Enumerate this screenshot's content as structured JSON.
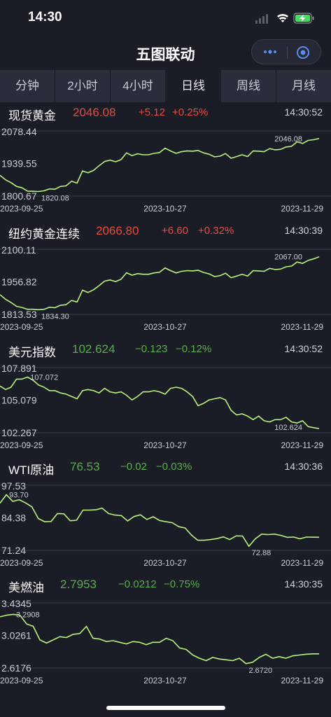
{
  "status_bar": {
    "time": "14:30",
    "battery_color": "#4cd964"
  },
  "navbar": {
    "title": "五图联动"
  },
  "tabs": [
    {
      "label": "分钟",
      "active": false
    },
    {
      "label": "2小时",
      "active": false
    },
    {
      "label": "4小时",
      "active": false
    },
    {
      "label": "日线",
      "active": true
    },
    {
      "label": "周线",
      "active": false
    },
    {
      "label": "月线",
      "active": false
    }
  ],
  "colors": {
    "up": "#e8493d",
    "down": "#52b044",
    "line": "#b8f27a",
    "background": "#1b1d26"
  },
  "panels": [
    {
      "name": "现货黄金",
      "price": "2046.08",
      "change": "+5.12",
      "pct": "+0.25%",
      "time": "14:30:52",
      "direction": "up"
    },
    {
      "name": "纽约黄金连续",
      "price": "2066.80",
      "change": "+6.60",
      "pct": "+0.32%",
      "time": "14:30:39",
      "direction": "up"
    },
    {
      "name": "美元指数",
      "price": "102.624",
      "change": "−0.123",
      "pct": "−0.12%",
      "time": "14:30:52",
      "direction": "down"
    },
    {
      "name": "WTI原油",
      "price": "76.53",
      "change": "−0.02",
      "pct": "−0.03%",
      "time": "14:30:36",
      "direction": "down"
    },
    {
      "name": "美燃油",
      "price": "2.7953",
      "change": "−0.0212",
      "pct": "−0.75%",
      "time": "14:30:35",
      "direction": "down"
    }
  ],
  "chart_data": [
    {
      "type": "line",
      "title": "现货黄金",
      "y_ticks": [
        "2078.44",
        "1939.55",
        "1800.67"
      ],
      "ylim": [
        1800.67,
        2078.44
      ],
      "x_ticks": [
        "2023-09-25",
        "2023-10-27",
        "2023-11-29"
      ],
      "low_label": "1820.08",
      "last_label": "2046.08",
      "values": [
        1889,
        1870,
        1858,
        1842,
        1836,
        1822,
        1821,
        1820.08,
        1823,
        1831,
        1830,
        1842,
        1844,
        1864,
        1856,
        1908,
        1900,
        1910,
        1930,
        1948,
        1954,
        1947,
        1956,
        1985,
        1973,
        1981,
        1977,
        1977,
        1983,
        1986,
        2005,
        1993,
        1983,
        1990,
        1993,
        1992,
        1995,
        1985,
        1979,
        1968,
        1971,
        1982,
        1962,
        1969,
        1977,
        1969,
        1993,
        1992,
        1990,
        2003,
        1998,
        2000,
        2010,
        2013,
        2032,
        2025,
        2038,
        2041,
        2046.08
      ]
    },
    {
      "type": "line",
      "title": "纽约黄金连续",
      "y_ticks": [
        "2100.11",
        "1956.82",
        "1813.53"
      ],
      "ylim": [
        1813.53,
        2100.11
      ],
      "x_ticks": [
        "2023-09-25",
        "2023-10-27",
        "2023-11-29"
      ],
      "low_label": "1834.30",
      "last_label": "2067.00",
      "values": [
        1900,
        1880,
        1866,
        1849,
        1844,
        1836,
        1836,
        1834.3,
        1836,
        1845,
        1843,
        1854,
        1856,
        1875,
        1868,
        1920,
        1910,
        1922,
        1940,
        1960,
        1965,
        1958,
        1968,
        1997,
        1986,
        1993,
        1990,
        1990,
        1996,
        1999,
        2018,
        2006,
        1996,
        2003,
        2006,
        2005,
        2008,
        1998,
        1992,
        1980,
        1984,
        1995,
        1975,
        1982,
        1990,
        1982,
        2006,
        2005,
        2003,
        2016,
        2011,
        2013,
        2023,
        2026,
        2044,
        2038,
        2051,
        2058,
        2067.0
      ]
    },
    {
      "type": "line",
      "title": "美元指数",
      "y_ticks": [
        "107.891",
        "105.079",
        "102.267"
      ],
      "ylim": [
        102.267,
        107.891
      ],
      "x_ticks": [
        "2023-09-25",
        "2023-10-27",
        "2023-11-29"
      ],
      "high_label": "107.072",
      "last_label": "102.624",
      "values": [
        106.3,
        106.0,
        106.2,
        106.9,
        106.9,
        107.072,
        106.8,
        106.4,
        106.2,
        105.9,
        105.9,
        105.7,
        105.6,
        105.4,
        105.2,
        105.9,
        106.0,
        105.9,
        105.7,
        106.1,
        105.8,
        105.7,
        105.8,
        105.5,
        105.1,
        105.4,
        105.8,
        105.8,
        105.9,
        105.8,
        105.6,
        106.1,
        106.2,
        106.1,
        105.8,
        105.4,
        104.6,
        104.8,
        105.1,
        105.2,
        105.3,
        105.1,
        104.2,
        103.8,
        103.9,
        103.7,
        103.4,
        103.7,
        103.3,
        103.2,
        103.4,
        103.4,
        103.6,
        103.2,
        103.1,
        103.3,
        102.8,
        102.7,
        102.624
      ]
    },
    {
      "type": "line",
      "title": "WTI原油",
      "y_ticks": [
        "97.53",
        "84.38",
        "71.24"
      ],
      "ylim": [
        71.24,
        97.53
      ],
      "x_ticks": [
        "2023-09-25",
        "2023-10-27",
        "2023-11-29"
      ],
      "high_label": "93.70",
      "low_label": "72.88",
      "values": [
        90.3,
        93.7,
        91.0,
        91.7,
        90.4,
        88.8,
        84.1,
        82.8,
        82.9,
        86.1,
        86.0,
        83.2,
        83.4,
        87.5,
        87.5,
        87.6,
        88.3,
        86.1,
        85.5,
        85.3,
        83.1,
        84.9,
        85.6,
        83.7,
        84.8,
        83.3,
        82.8,
        82.4,
        80.8,
        80.3,
        77.4,
        75.3,
        75.3,
        75.6,
        76.0,
        76.7,
        75.6,
        77.1,
        77.0,
        72.88,
        75.9,
        77.8,
        77.6,
        77.8,
        77.3,
        76.5,
        76.6,
        75.9,
        76.6,
        76.55,
        76.53
      ]
    },
    {
      "type": "line",
      "title": "美燃油",
      "y_ticks": [
        "3.4345",
        "3.0261",
        "2.6176"
      ],
      "ylim": [
        2.6176,
        3.4345
      ],
      "x_ticks": [
        "2023-09-25",
        "2023-10-27",
        "2023-11-29"
      ],
      "high_label": "3.2908",
      "low_label": "2.6720",
      "last_label": "",
      "values": [
        3.26,
        3.28,
        3.2908,
        3.28,
        3.17,
        3.14,
        2.97,
        2.93,
        2.97,
        3.01,
        3.0,
        3.04,
        3.05,
        3.14,
        2.99,
        2.98,
        2.95,
        2.96,
        2.94,
        2.92,
        2.95,
        2.94,
        2.91,
        2.94,
        2.94,
        2.99,
        2.96,
        2.87,
        2.85,
        2.78,
        2.74,
        2.71,
        2.75,
        2.73,
        2.72,
        2.71,
        2.74,
        2.672,
        2.69,
        2.75,
        2.79,
        2.74,
        2.76,
        2.74,
        2.77,
        2.78,
        2.79,
        2.795,
        2.7953
      ]
    }
  ]
}
